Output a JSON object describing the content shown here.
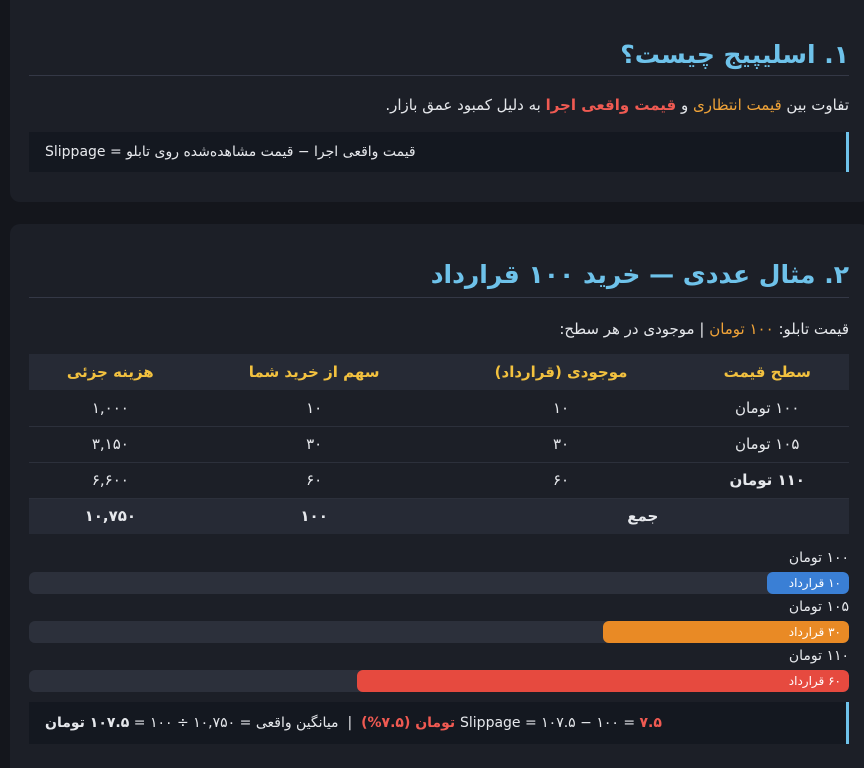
{
  "section1": {
    "heading": "۱. اسلیپیج چیست؟",
    "para": {
      "p1": "تفاوت بین ",
      "hl1": "قیمت انتظاری",
      "p2": " و ",
      "hl2": "قیمت واقعی اجرا",
      "p3": " به دلیل کمبود عمق بازار."
    },
    "formula": "Slippage = قیمت واقعی اجرا − قیمت مشاهده‌شده روی تابلو"
  },
  "section2": {
    "heading": "۲. مثال عددی — خرید ۱۰۰ قرارداد",
    "intro": {
      "p1": "قیمت تابلو: ",
      "hl": "۱۰۰ تومان",
      "p2": " | موجودی در هر سطح:"
    },
    "table": {
      "headers": [
        "سطح قیمت",
        "موجودی (قرارداد)",
        "سهم از خرید شما",
        "هزینه جزئی"
      ],
      "rows": [
        [
          "۱۰۰ تومان",
          "۱۰",
          "۱۰",
          "۱,۰۰۰"
        ],
        [
          "۱۰۵ تومان",
          "۳۰",
          "۳۰",
          "۳,۱۵۰"
        ],
        [
          "۱۱۰ تومان",
          "۶۰",
          "۶۰",
          "۶,۶۰۰"
        ]
      ],
      "total": {
        "label": "جمع",
        "share": "۱۰۰",
        "cost": "۱۰,۷۵۰"
      }
    },
    "bars": [
      {
        "label": "۱۰۰ تومان",
        "fill_label": "۱۰ قرارداد",
        "fraction": 0.1,
        "color": "#3a7fd5"
      },
      {
        "label": "۱۰۵ تومان",
        "fill_label": "۳۰ قرارداد",
        "fraction": 0.3,
        "color": "#e98a25"
      },
      {
        "label": "۱۱۰ تومان",
        "fill_label": "۶۰ قرارداد",
        "fraction": 0.6,
        "color": "#e64a3f"
      }
    ],
    "summary": {
      "avg_label": "میانگین واقعی = ۱۰,۷۵۰ ÷ ۱۰۰ = ",
      "avg_value": "۱۰۷.۵ تومان",
      "sep": "  |  ",
      "slip_label": "Slippage = ۱۰۷.۵ − ۱۰۰ = ",
      "slip_value": "۷.۵ تومان (۷.۵%)"
    }
  }
}
